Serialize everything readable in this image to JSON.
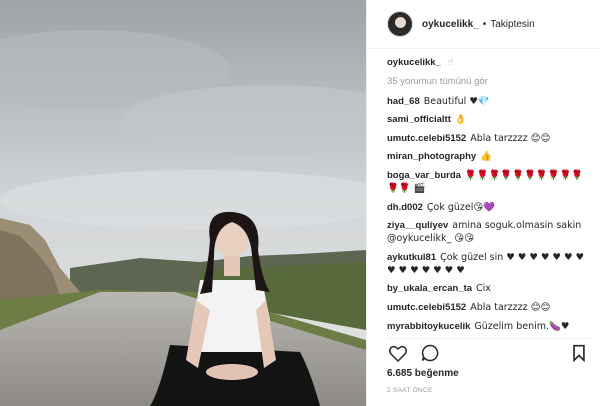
{
  "post": {
    "username": "oykucelikk_",
    "follow_status": "Takiptesin",
    "separator": "•",
    "caption_user": "oykucelikk_",
    "caption_text": "☝",
    "view_all_comments": "35 yorumun tümünü gör",
    "likes": "6.685 beğenme",
    "time_ago": "2 SAAT ÖNCE"
  },
  "comments": [
    {
      "user": "had_68",
      "text": "Beautiful ♥💎"
    },
    {
      "user": "sami_officialtt",
      "text": "👌"
    },
    {
      "user": "umutc.celebi5152",
      "text": "Abla tarzzzz 😊😊"
    },
    {
      "user": "miran_photography",
      "text": "👍"
    },
    {
      "user": "boga_var_burda",
      "text": "🌹🌹🌹🌹🌹🌹🌹🌹🌹🌹🌹🌹 🎬"
    },
    {
      "user": "dh.d002",
      "text": "Çok güzel😘💜"
    },
    {
      "user": "ziya__quliyev",
      "text": "amina soguk.olmasin sakin @oykucelikk_ 😘😘"
    },
    {
      "user": "aykutkul81",
      "text": "Çok güzel sin ♥ ♥ ♥ ♥ ♥ ♥ ♥ ♥ ♥ ♥ ♥ ♥ ♥ ♥"
    },
    {
      "user": "by_ukala_ercan_ta",
      "text": "Cix"
    },
    {
      "user": "umutc.celebi5152",
      "text": "Abla tarzzzz 😊😊"
    },
    {
      "user": "myrabbitoykucelik",
      "text": "Güzelim benim.🍆♥"
    }
  ],
  "icons": {
    "like": "heart-icon",
    "comment": "comment-icon",
    "save": "bookmark-icon"
  },
  "colors": {
    "text": "#262626",
    "muted": "#999999",
    "border": "#efefef"
  }
}
